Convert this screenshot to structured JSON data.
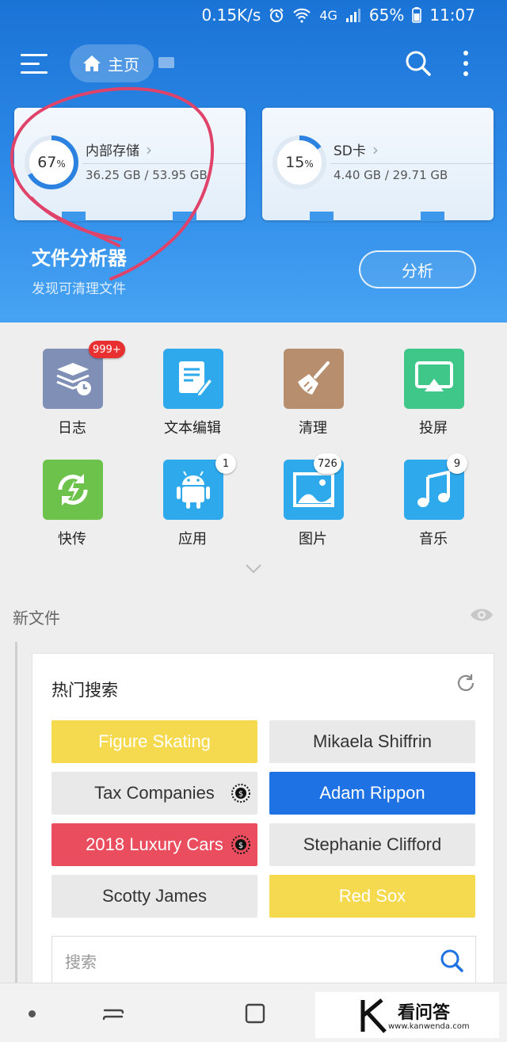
{
  "status": {
    "speed": "0.15K/s",
    "network": "4G",
    "battery": "65%",
    "time": "11:07"
  },
  "toolbar": {
    "home_label": "主页"
  },
  "storage": [
    {
      "percent": "67",
      "percent_value": 67,
      "unit": "%",
      "name": "内部存储",
      "size": "36.25 GB / 53.95 GB"
    },
    {
      "percent": "15",
      "percent_value": 15,
      "unit": "%",
      "name": "SD卡",
      "size": "4.40 GB / 29.71 GB"
    }
  ],
  "analyzer": {
    "title": "文件分析器",
    "subtitle": "发现可清理文件",
    "button": "分析"
  },
  "apps": [
    {
      "label": "日志",
      "badge": "999+",
      "icon": "log-icon",
      "color": "#7f8fb6"
    },
    {
      "label": "文本编辑",
      "badge": "",
      "icon": "note-edit-icon",
      "color": "#2ea9ec"
    },
    {
      "label": "清理",
      "badge": "",
      "icon": "broom-icon",
      "color": "#b88f6e"
    },
    {
      "label": "投屏",
      "badge": "",
      "icon": "cast-screen-icon",
      "color": "#3ec788"
    },
    {
      "label": "快传",
      "badge": "",
      "icon": "quick-transfer-icon",
      "color": "#6cc24a"
    },
    {
      "label": "应用",
      "badge": "1",
      "icon": "android-icon",
      "color": "#2ea9ec"
    },
    {
      "label": "图片",
      "badge": "726",
      "icon": "image-icon",
      "color": "#2ea9ec"
    },
    {
      "label": "音乐",
      "badge": "9",
      "icon": "music-icon",
      "color": "#2ea9ec"
    }
  ],
  "new_files": {
    "label": "新文件"
  },
  "hot_search": {
    "title": "热门搜索",
    "tags": [
      {
        "text": "Figure Skating",
        "style": "yellow"
      },
      {
        "text": "Mikaela Shiffrin",
        "style": "gray"
      },
      {
        "text": "Tax Companies",
        "style": "gray"
      },
      {
        "text": "Adam Rippon",
        "style": "blue"
      },
      {
        "text": "2018 Luxury Cars",
        "style": "red"
      },
      {
        "text": "Stephanie Clifford",
        "style": "gray"
      },
      {
        "text": "Scotty James",
        "style": "gray"
      },
      {
        "text": "Red Sox",
        "style": "yellow"
      }
    ],
    "search_placeholder": "搜索"
  },
  "watermark": {
    "title": "看问答",
    "url": "www.kanwenda.com"
  }
}
